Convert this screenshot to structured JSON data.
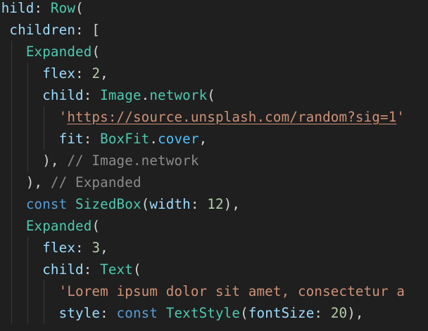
{
  "editor": {
    "language": "dart",
    "lines": [
      {
        "indent": 0,
        "tokens": [
          {
            "t": "child",
            "k": "prop"
          },
          {
            "t": ": ",
            "k": "punc"
          },
          {
            "t": "Row",
            "k": "type"
          },
          {
            "t": "(",
            "k": "punc"
          }
        ]
      },
      {
        "indent": 1,
        "tokens": [
          {
            "t": "children",
            "k": "prop"
          },
          {
            "t": ": [",
            "k": "punc"
          }
        ]
      },
      {
        "indent": 2,
        "tokens": [
          {
            "t": "Expanded",
            "k": "type"
          },
          {
            "t": "(",
            "k": "punc"
          }
        ]
      },
      {
        "indent": 3,
        "tokens": [
          {
            "t": "flex",
            "k": "prop"
          },
          {
            "t": ": ",
            "k": "punc"
          },
          {
            "t": "2",
            "k": "num"
          },
          {
            "t": ",",
            "k": "punc"
          }
        ]
      },
      {
        "indent": 3,
        "tokens": [
          {
            "t": "child",
            "k": "prop"
          },
          {
            "t": ": ",
            "k": "punc"
          },
          {
            "t": "Image",
            "k": "type"
          },
          {
            "t": ".",
            "k": "punc"
          },
          {
            "t": "network",
            "k": "type"
          },
          {
            "t": "(",
            "k": "punc"
          }
        ]
      },
      {
        "indent": 4,
        "tokens": [
          {
            "t": "'",
            "k": "str"
          },
          {
            "t": "https://source.unsplash.com/random?sig=1",
            "k": "url"
          },
          {
            "t": "'",
            "k": "str"
          }
        ]
      },
      {
        "indent": 4,
        "tokens": [
          {
            "t": "fit",
            "k": "prop"
          },
          {
            "t": ": ",
            "k": "punc"
          },
          {
            "t": "BoxFit",
            "k": "type"
          },
          {
            "t": ".",
            "k": "punc"
          },
          {
            "t": "cover",
            "k": "enm"
          },
          {
            "t": ",",
            "k": "punc"
          }
        ]
      },
      {
        "indent": 3,
        "tokens": [
          {
            "t": "), ",
            "k": "punc"
          },
          {
            "t": "// Image.network",
            "k": "cmt"
          }
        ]
      },
      {
        "indent": 2,
        "tokens": [
          {
            "t": "), ",
            "k": "punc"
          },
          {
            "t": "// Expanded",
            "k": "cmt"
          }
        ]
      },
      {
        "indent": 2,
        "tokens": [
          {
            "t": "const ",
            "k": "kw"
          },
          {
            "t": "SizedBox",
            "k": "type"
          },
          {
            "t": "(",
            "k": "punc"
          },
          {
            "t": "width",
            "k": "prop"
          },
          {
            "t": ": ",
            "k": "punc"
          },
          {
            "t": "12",
            "k": "num"
          },
          {
            "t": "),",
            "k": "punc"
          }
        ]
      },
      {
        "indent": 2,
        "tokens": [
          {
            "t": "Expanded",
            "k": "type"
          },
          {
            "t": "(",
            "k": "punc"
          }
        ]
      },
      {
        "indent": 3,
        "tokens": [
          {
            "t": "flex",
            "k": "prop"
          },
          {
            "t": ": ",
            "k": "punc"
          },
          {
            "t": "3",
            "k": "num"
          },
          {
            "t": ",",
            "k": "punc"
          }
        ]
      },
      {
        "indent": 3,
        "tokens": [
          {
            "t": "child",
            "k": "prop"
          },
          {
            "t": ": ",
            "k": "punc"
          },
          {
            "t": "Text",
            "k": "type"
          },
          {
            "t": "(",
            "k": "punc"
          }
        ]
      },
      {
        "indent": 4,
        "tokens": [
          {
            "t": "'Lorem ipsum dolor sit amet, consectetur a",
            "k": "str"
          }
        ]
      },
      {
        "indent": 4,
        "tokens": [
          {
            "t": "style",
            "k": "prop"
          },
          {
            "t": ": ",
            "k": "punc"
          },
          {
            "t": "const ",
            "k": "kw"
          },
          {
            "t": "TextStyle",
            "k": "type"
          },
          {
            "t": "(",
            "k": "punc"
          },
          {
            "t": "fontSize",
            "k": "prop"
          },
          {
            "t": ": ",
            "k": "punc"
          },
          {
            "t": "20",
            "k": "num"
          },
          {
            "t": "),",
            "k": "punc"
          }
        ]
      }
    ]
  }
}
